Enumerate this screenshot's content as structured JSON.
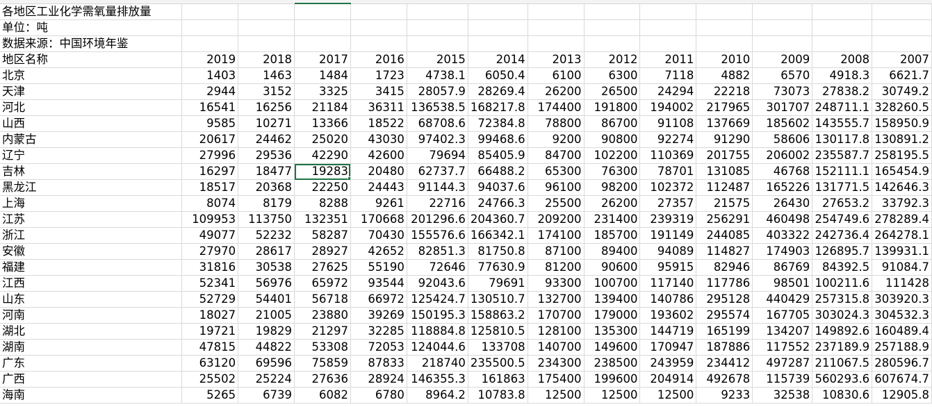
{
  "sheet": {
    "title": "各地区工业化学需氧量排放量",
    "unit": "单位：吨",
    "source": "数据来源：中国环境年鉴",
    "header_label": "地区名称",
    "years": [
      "2019",
      "2018",
      "2017",
      "2016",
      "2015",
      "2014",
      "2013",
      "2012",
      "2011",
      "2010",
      "2009",
      "2008",
      "2007"
    ],
    "rows": [
      {
        "region": "北京",
        "values": [
          "1403",
          "1463",
          "1484",
          "1723",
          "4738.1",
          "6050.4",
          "6100",
          "6300",
          "7118",
          "4882",
          "6570",
          "4918.3",
          "6621.7"
        ]
      },
      {
        "region": "天津",
        "values": [
          "2944",
          "3152",
          "3325",
          "3415",
          "28057.9",
          "28269.4",
          "26200",
          "26500",
          "24294",
          "22218",
          "73073",
          "27838.2",
          "30749.2"
        ]
      },
      {
        "region": "河北",
        "values": [
          "16541",
          "16256",
          "21184",
          "36311",
          "136538.5",
          "168217.8",
          "174400",
          "191800",
          "194002",
          "217965",
          "301707",
          "248711.1",
          "328260.5"
        ]
      },
      {
        "region": "山西",
        "values": [
          "9585",
          "10271",
          "13366",
          "18522",
          "68708.6",
          "72384.8",
          "78800",
          "86700",
          "91108",
          "137669",
          "185602",
          "143555.7",
          "158950.9"
        ]
      },
      {
        "region": "内蒙古",
        "values": [
          "20617",
          "24462",
          "25020",
          "43030",
          "97402.3",
          "99468.6",
          "9200",
          "90800",
          "92274",
          "91290",
          "58606",
          "130117.8",
          "130891.2"
        ]
      },
      {
        "region": "辽宁",
        "values": [
          "27996",
          "29536",
          "42290",
          "42600",
          "79694",
          "85405.9",
          "84700",
          "102200",
          "110369",
          "201755",
          "206002",
          "235587.7",
          "258195.5"
        ]
      },
      {
        "region": "吉林",
        "values": [
          "16297",
          "18477",
          "19283",
          "20480",
          "62737.7",
          "66488.2",
          "65300",
          "76300",
          "78701",
          "131085",
          "46768",
          "152111.1",
          "165454.9"
        ]
      },
      {
        "region": "黑龙江",
        "values": [
          "18517",
          "20368",
          "22250",
          "24443",
          "91144.3",
          "94037.6",
          "96100",
          "98200",
          "102372",
          "112487",
          "165226",
          "131771.5",
          "142646.3"
        ]
      },
      {
        "region": "上海",
        "values": [
          "8074",
          "8179",
          "8288",
          "9261",
          "22716",
          "24766.3",
          "25500",
          "26200",
          "27357",
          "21575",
          "26430",
          "27653.2",
          "33792.3"
        ]
      },
      {
        "region": "江苏",
        "values": [
          "109953",
          "113750",
          "132351",
          "170668",
          "201296.6",
          "204360.7",
          "209200",
          "231400",
          "239319",
          "256291",
          "460498",
          "254749.6",
          "278289.4"
        ]
      },
      {
        "region": "浙江",
        "values": [
          "49077",
          "52232",
          "58287",
          "70430",
          "155576.6",
          "166342.1",
          "174100",
          "185700",
          "191149",
          "244085",
          "403322",
          "242736.4",
          "264278.1"
        ]
      },
      {
        "region": "安徽",
        "values": [
          "27970",
          "28617",
          "28927",
          "42652",
          "82851.3",
          "81750.8",
          "87100",
          "89400",
          "94089",
          "114827",
          "174903",
          "126895.7",
          "139931.1"
        ]
      },
      {
        "region": "福建",
        "values": [
          "31816",
          "30538",
          "27625",
          "55190",
          "72646",
          "77630.9",
          "81200",
          "90600",
          "95915",
          "82946",
          "86769",
          "84392.5",
          "91084.7"
        ]
      },
      {
        "region": "江西",
        "values": [
          "52341",
          "56976",
          "65972",
          "93544",
          "92043.6",
          "79691",
          "93300",
          "100700",
          "117140",
          "117786",
          "98501",
          "100211.6",
          "111428"
        ]
      },
      {
        "region": "山东",
        "values": [
          "52729",
          "54401",
          "56718",
          "66972",
          "125424.7",
          "130510.7",
          "132700",
          "139400",
          "140786",
          "295128",
          "440429",
          "257315.8",
          "303920.3"
        ]
      },
      {
        "region": "河南",
        "values": [
          "18027",
          "21005",
          "23880",
          "39269",
          "150195.3",
          "158863.2",
          "170700",
          "179000",
          "193602",
          "295574",
          "167705",
          "303024.3",
          "304532.3"
        ]
      },
      {
        "region": "湖北",
        "values": [
          "19721",
          "19829",
          "21297",
          "32285",
          "118884.8",
          "125810.5",
          "128100",
          "135300",
          "144719",
          "165199",
          "134207",
          "149892.6",
          "160489.4"
        ]
      },
      {
        "region": "湖南",
        "values": [
          "47815",
          "44822",
          "53308",
          "72053",
          "124044.6",
          "133708",
          "140700",
          "149600",
          "170947",
          "187886",
          "117552",
          "237189.9",
          "257188.9"
        ]
      },
      {
        "region": "广东",
        "values": [
          "63120",
          "69596",
          "75859",
          "87833",
          "218740",
          "235500.5",
          "234300",
          "238500",
          "243959",
          "234412",
          "497287",
          "211067.5",
          "280596.7"
        ]
      },
      {
        "region": "广西",
        "values": [
          "25502",
          "25224",
          "27636",
          "28924",
          "146355.3",
          "161863",
          "175400",
          "199600",
          "204914",
          "492678",
          "115739",
          "560293.6",
          "607674.7"
        ]
      },
      {
        "region": "海南",
        "values": [
          "5265",
          "6739",
          "6082",
          "6780",
          "8964.2",
          "10783.8",
          "12500",
          "12500",
          "12500",
          "9233",
          "32538",
          "10830.6",
          "12905.8"
        ]
      }
    ]
  }
}
